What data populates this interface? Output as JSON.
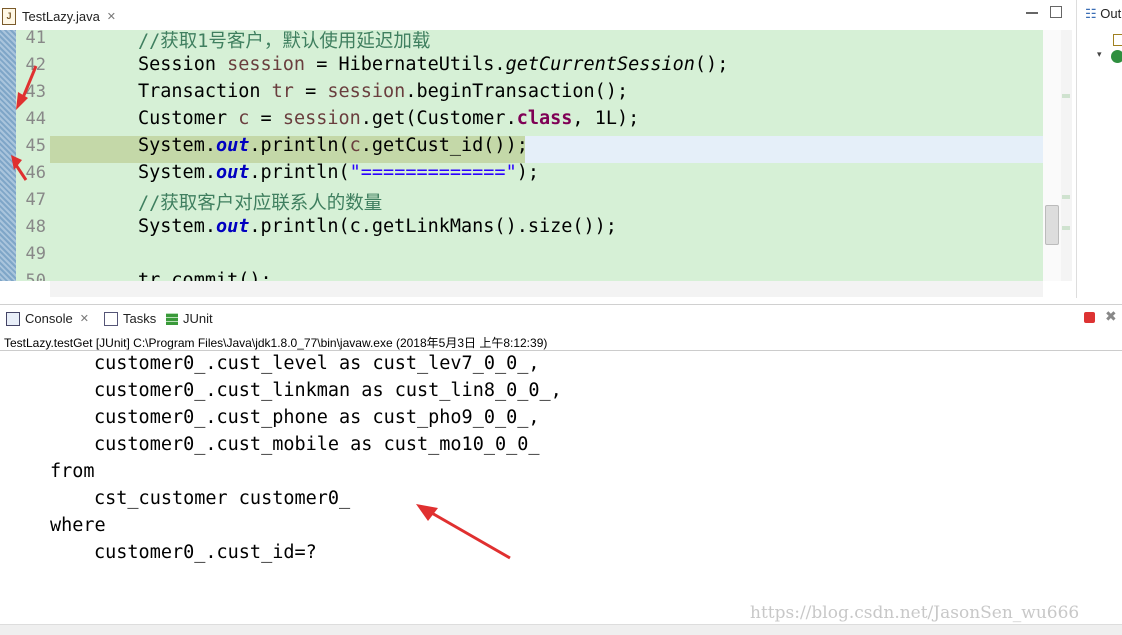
{
  "editor": {
    "tab_label": "TestLazy.java",
    "close_glyph": "✕",
    "lines": [
      {
        "num": "41",
        "segments": [
          {
            "cls": "cm",
            "t": "//获取1号客户，默认使用延迟加载"
          }
        ]
      },
      {
        "num": "42",
        "segments": [
          {
            "cls": "",
            "t": "Session "
          },
          {
            "cls": "vr",
            "t": "session"
          },
          {
            "cls": "",
            "t": " = HibernateUtils."
          },
          {
            "cls": "mth",
            "t": "getCurrentSession"
          },
          {
            "cls": "",
            "t": "();"
          }
        ]
      },
      {
        "num": "43",
        "segments": [
          {
            "cls": "",
            "t": "Transaction "
          },
          {
            "cls": "vr",
            "t": "tr"
          },
          {
            "cls": "",
            "t": " = "
          },
          {
            "cls": "vr",
            "t": "session"
          },
          {
            "cls": "",
            "t": ".beginTransaction();"
          }
        ]
      },
      {
        "num": "44",
        "segments": [
          {
            "cls": "",
            "t": "Customer "
          },
          {
            "cls": "vr",
            "t": "c"
          },
          {
            "cls": "",
            "t": " = "
          },
          {
            "cls": "vr",
            "t": "session"
          },
          {
            "cls": "",
            "t": ".get(Customer."
          },
          {
            "cls": "kw",
            "t": "class"
          },
          {
            "cls": "",
            "t": ", 1L);"
          }
        ]
      },
      {
        "num": "45",
        "segments": [
          {
            "cls": "",
            "t": "System."
          },
          {
            "cls": "fld",
            "t": "out"
          },
          {
            "cls": "",
            "t": ".println("
          },
          {
            "cls": "vr",
            "t": "c"
          },
          {
            "cls": "",
            "t": ".getCust_id());"
          }
        ]
      },
      {
        "num": "46",
        "segments": [
          {
            "cls": "",
            "t": "System."
          },
          {
            "cls": "fld",
            "t": "out"
          },
          {
            "cls": "",
            "t": ".println("
          },
          {
            "cls": "st",
            "t": "\"=============\""
          },
          {
            "cls": "",
            "t": ");"
          }
        ]
      },
      {
        "num": "47",
        "segments": [
          {
            "cls": "cm",
            "t": "//获取客户对应联系人的数量"
          }
        ]
      },
      {
        "num": "48",
        "segments": [
          {
            "cls": "",
            "t": "System."
          },
          {
            "cls": "fld",
            "t": "out"
          },
          {
            "cls": "",
            "t": ".println(c.getLinkMans().size());"
          }
        ]
      },
      {
        "num": "49",
        "segments": []
      },
      {
        "num": "50",
        "segments": [
          {
            "cls": "",
            "t": "tr.commit();"
          }
        ]
      }
    ]
  },
  "side_panel": {
    "outline_label": "Outl"
  },
  "console": {
    "tabs": [
      {
        "label": "Console",
        "icon": "console-icon"
      },
      {
        "label": "Tasks",
        "icon": "tasks-icon"
      },
      {
        "label": "JUnit",
        "icon": "junit-icon"
      }
    ],
    "launch_label": "TestLazy.testGet [JUnit] C:\\Program Files\\Java\\jdk1.8.0_77\\bin\\javaw.exe (2018年5月3日 上午8:12:39)",
    "output_lines": [
      {
        "indent": 2,
        "text": "customer0_.cust_level as cust_lev7_0_0_,"
      },
      {
        "indent": 2,
        "text": "customer0_.cust_linkman as cust_lin8_0_0_,"
      },
      {
        "indent": 2,
        "text": "customer0_.cust_phone as cust_pho9_0_0_,"
      },
      {
        "indent": 2,
        "text": "customer0_.cust_mobile as cust_mo10_0_0_"
      },
      {
        "indent": 1,
        "text": "from"
      },
      {
        "indent": 2,
        "text": "cst_customer customer0_"
      },
      {
        "indent": 1,
        "text": "where"
      },
      {
        "indent": 2,
        "text": "customer0_.cust_id=?"
      }
    ]
  },
  "watermark": "https://blog.csdn.net/JasonSen_wu666",
  "colors": {
    "annotation_arrow": "#e03030",
    "editor_bg": "#d6f0d6"
  }
}
